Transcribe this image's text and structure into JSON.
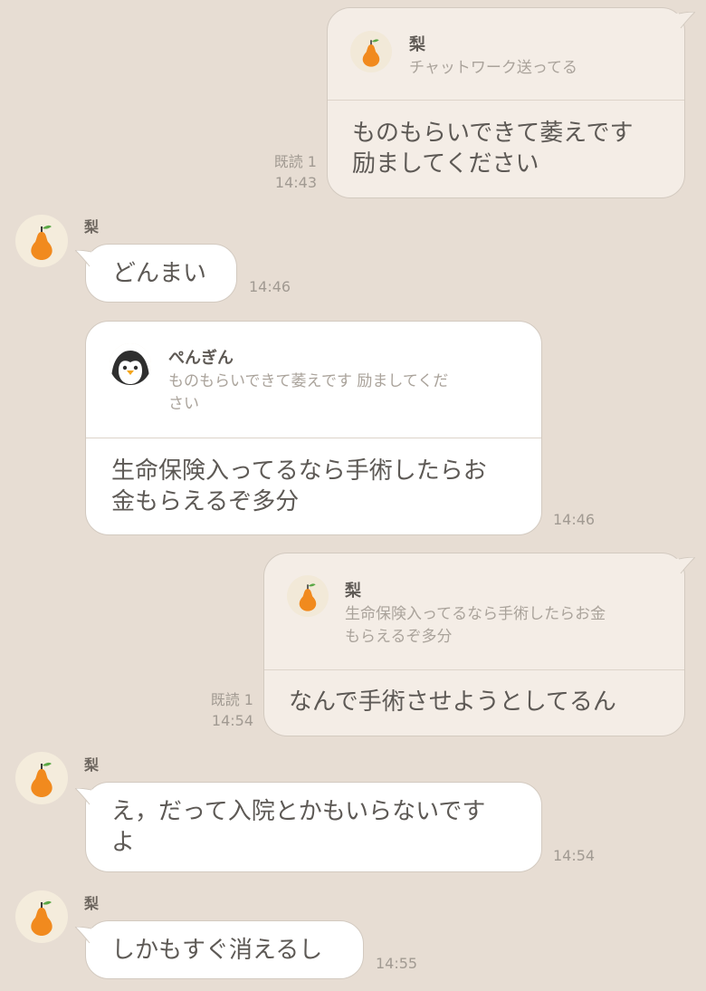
{
  "messages": [
    {
      "direction": "outgoing",
      "quote": {
        "name": "梨",
        "text": "チャットワーク送ってる"
      },
      "lines": [
        "ものもらいできて萎えです",
        "励ましてください"
      ],
      "read": "既読 1",
      "time": "14:43"
    },
    {
      "direction": "incoming",
      "sender": "梨",
      "lines": [
        "どんまい"
      ],
      "time": "14:46"
    },
    {
      "direction": "incoming",
      "quote": {
        "name": "ぺんぎん",
        "lines": [
          "ものもらいできて萎えです 励ましてくだ",
          "さい"
        ]
      },
      "lines": [
        "生命保険入ってるなら手術したらお",
        "金もらえるぞ多分"
      ],
      "time": "14:46"
    },
    {
      "direction": "outgoing",
      "quote": {
        "name": "梨",
        "lines": [
          "生命保険入ってるなら手術したらお金",
          "もらえるぞ多分"
        ]
      },
      "lines": [
        "なんで手術させようとしてるん"
      ],
      "read": "既読 1",
      "time": "14:54"
    },
    {
      "direction": "incoming",
      "sender": "梨",
      "lines": [
        "え，だって入院とかもいらないです",
        "よ"
      ],
      "time": "14:54"
    },
    {
      "direction": "incoming",
      "sender": "梨",
      "lines": [
        "しかもすぐ消えるし"
      ],
      "time": "14:55"
    }
  ],
  "colors": {
    "background": "#e7ddd3",
    "incoming_bubble": "#ffffff",
    "outgoing_bubble": "#f4ede6",
    "pear": "#f18a1e",
    "leaf": "#5aa845"
  },
  "icons": {
    "pear_avatar": "pear-icon",
    "penguin_avatar": "penguin-icon"
  }
}
